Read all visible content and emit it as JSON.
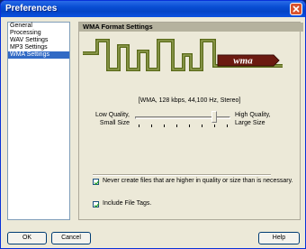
{
  "window": {
    "title": "Preferences"
  },
  "nav": {
    "items": [
      {
        "label": "General"
      },
      {
        "label": "Processing"
      },
      {
        "label": "WAV Settings"
      },
      {
        "label": "MP3 Settings"
      },
      {
        "label": "WMA Settings"
      }
    ],
    "selected_index": 4
  },
  "panel": {
    "header": "WMA Format Settings",
    "logo_text": "wma",
    "format_description": "[WMA, 128 kbps, 44,100 Hz, Stereo]",
    "quality_low_line1": "Low Quality,",
    "quality_low_line2": "Small Size",
    "quality_high_line1": "High Quality,",
    "quality_high_line2": "Large Size",
    "quality_slider_position": 0.85,
    "quality_slider_ticks": 8,
    "option_never_larger": {
      "label": "Never create files that are higher in quality or size than is necessary.",
      "checked": true
    },
    "option_include_tags": {
      "label": "Include File Tags.",
      "checked": true
    }
  },
  "buttons": {
    "ok": "OK",
    "cancel": "Cancel",
    "help": "Help"
  },
  "colors": {
    "selection": "#316ac5",
    "titlebar": "#0a4fd4",
    "logo_olive": "#5a6a1a"
  }
}
